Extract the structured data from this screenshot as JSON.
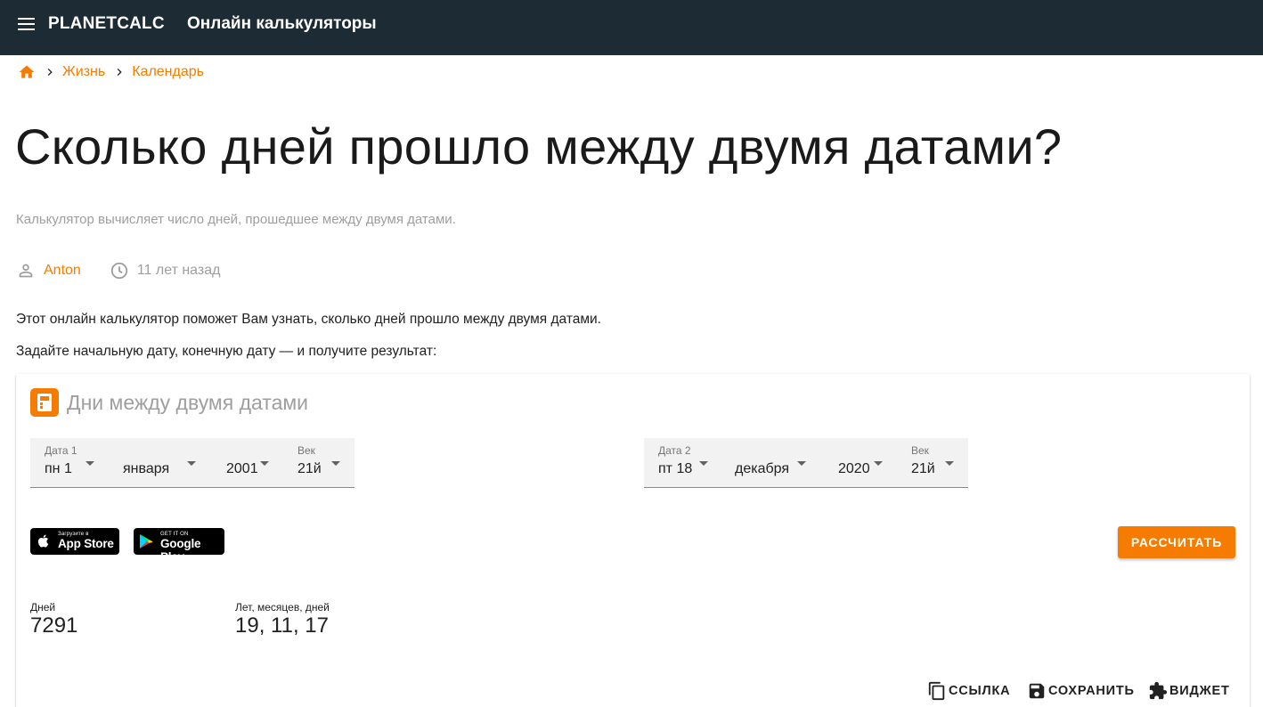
{
  "header": {
    "brand": "PLANETCALC",
    "nav_title": "Онлайн калькуляторы"
  },
  "breadcrumb": {
    "items": [
      "Жизнь",
      "Календарь"
    ]
  },
  "page": {
    "title": "Сколько дней прошло между двумя датами?",
    "subtitle": "Калькулятор вычисляет число дней, прошедшее между двумя датами.",
    "author": "Anton",
    "published": "11 лет назад",
    "intro_1": "Этот онлайн калькулятор поможет Вам узнать, сколько дней прошло между двумя датами.",
    "intro_2": "Задайте начальную дату, конечную дату — и получите результат:"
  },
  "calculator": {
    "title": "Дни между двумя датами",
    "date1": {
      "label": "Дата 1",
      "day": "пн 1",
      "month": "января",
      "year": "2001",
      "century_label": "Век",
      "century": "21й"
    },
    "date2": {
      "label": "Дата 2",
      "day": "пт 18",
      "month": "декабря",
      "year": "2020",
      "century_label": "Век",
      "century": "21й"
    },
    "app_store": {
      "small": "Загрузите в",
      "big": "App Store"
    },
    "google_play": {
      "small": "GET IT ON",
      "big": "Google Play"
    },
    "calculate_label": "РАССЧИТАТЬ",
    "results": {
      "days_label": "Дней",
      "days_value": "7291",
      "ymd_label": "Лет, месяцев, дней",
      "ymd_value": "19, 11, 17"
    },
    "actions": {
      "link": "ССЫЛКА",
      "save": "СОХРАНИТЬ",
      "widget": "ВИДЖЕТ"
    }
  },
  "colors": {
    "topbar": "#1d2b34",
    "accent": "#f57c00",
    "muted_text": "#9e9e9e",
    "field_bg": "#f2f2f2"
  },
  "icons": [
    "menu-icon",
    "home-icon",
    "chevron-right-icon",
    "person-icon",
    "clock-icon",
    "calculator-logo-icon",
    "apple-icon",
    "google-play-icon",
    "copy-icon",
    "save-icon",
    "puzzle-icon"
  ]
}
